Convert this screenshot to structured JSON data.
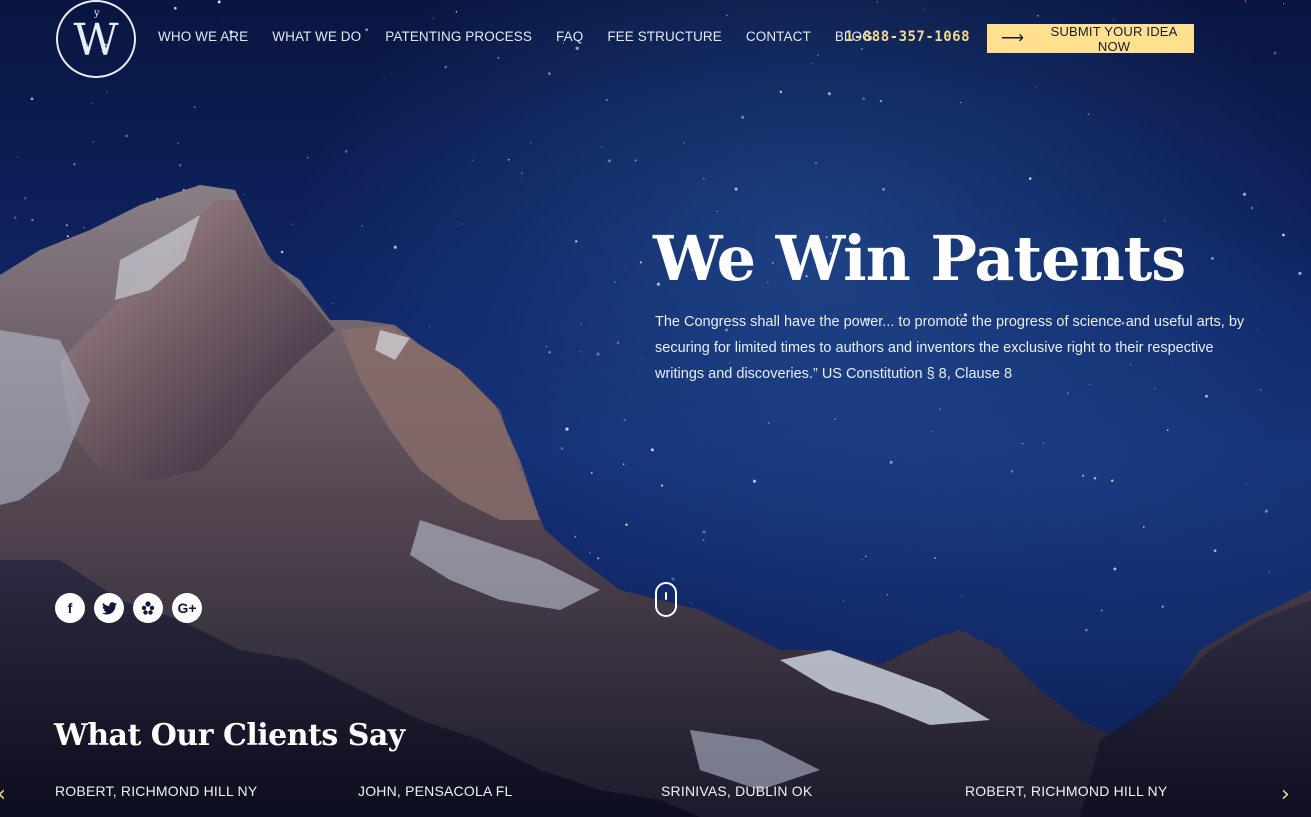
{
  "header": {
    "logo_letter": "W",
    "logo_sub_i": "i",
    "logo_sub_p": "P",
    "logo_sub_top": "y",
    "nav": [
      "WHO WE ARE",
      "WHAT WE DO",
      "PATENTING PROCESS",
      "FAQ",
      "FEE STRUCTURE",
      "CONTACT",
      "BLOG"
    ],
    "phone": "1-888-357-1068",
    "cta_label": "SUBMIT YOUR IDEA NOW",
    "cta_color": "#ffe08f",
    "phone_color": "#f5d98c"
  },
  "hero": {
    "headline": "We Win Patents",
    "quote": "The Congress shall have the power... to promote the progress of science and useful arts, by securing for limited times to authors and inventors the exclusive right to their respective writings and discoveries.” US Constitution § 8, Clause 8"
  },
  "socials": [
    {
      "icon": "facebook-icon",
      "glyph": "f"
    },
    {
      "icon": "twitter-icon",
      "glyph": "t"
    },
    {
      "icon": "yelp-icon",
      "glyph": "y"
    },
    {
      "icon": "google-plus-icon",
      "glyph": "G+"
    }
  ],
  "testimonials": {
    "title": "What Our Clients Say",
    "names": [
      "ROBERT, RICHMOND HILL NY",
      "JOHN, PENSACOLA FL",
      "SRINIVAS, DUBLIN OK",
      "ROBERT, RICHMOND HILL NY"
    ],
    "prev_glyph": "‹",
    "next_glyph": "›"
  }
}
